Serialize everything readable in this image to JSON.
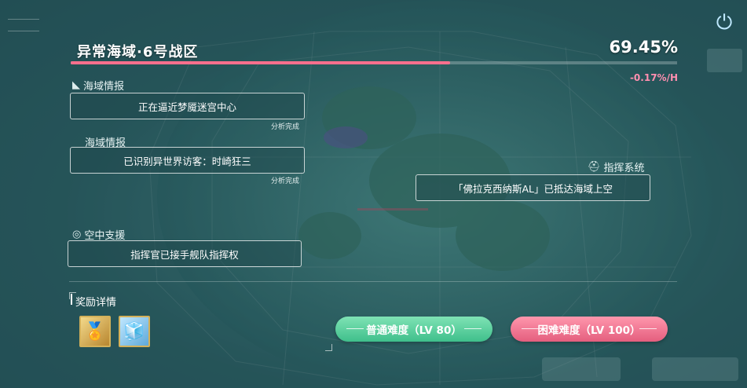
{
  "header": {
    "title": "异常海域·6号战区",
    "progress_percent_text": "69.45%",
    "progress_fraction": 0.6945,
    "rate_text": "-0.17%/H"
  },
  "sections": {
    "sea_intel_1": {
      "label": "海域情报",
      "content": "正在逼近梦魇迷宫中心",
      "note": "分析完成"
    },
    "sea_intel_2": {
      "label": "海域情报",
      "content": "已识别异世界访客：时崎狂三",
      "note": "分析完成"
    },
    "command": {
      "label": "指挥系统",
      "content": "「佛拉克西纳斯AL」已抵达海域上空"
    },
    "air_support": {
      "label": "空中支援",
      "content": "指挥官已接手舰队指挥权"
    }
  },
  "rewards": {
    "title": "奖励详情",
    "items": [
      {
        "icon": "gold-medal-icon"
      },
      {
        "icon": "ice-cube-icon"
      }
    ]
  },
  "buttons": {
    "normal": "普通难度（LV 80）",
    "hard": "困难难度（LV 100）"
  },
  "colors": {
    "progress": "#ff6f8d",
    "normal_button": "#4fcf98",
    "hard_button": "#ef7090",
    "rate": "#ff8fb0"
  }
}
